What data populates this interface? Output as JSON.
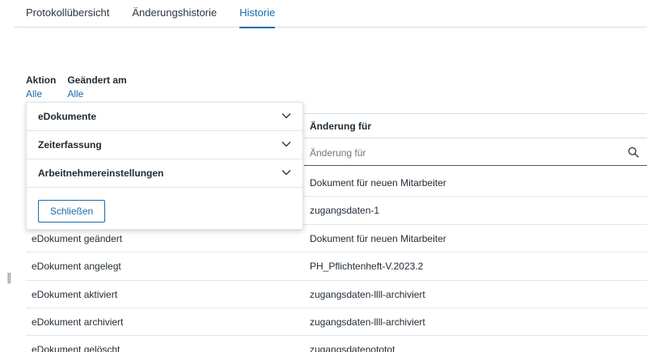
{
  "tabs": [
    {
      "label": "Protokollübersicht",
      "active": false
    },
    {
      "label": "Änderungshistorie",
      "active": false
    },
    {
      "label": "Historie",
      "active": true
    }
  ],
  "filters": {
    "action": {
      "label": "Aktion",
      "value": "Alle"
    },
    "changed_at": {
      "label": "Geändert am",
      "value": "Alle"
    }
  },
  "dropdown": {
    "items": [
      "eDokumente",
      "Zeiterfassung",
      "Arbeitnehmereinstellungen"
    ],
    "close_label": "Schließen"
  },
  "table": {
    "column_right": "Änderung für",
    "filter_placeholder": "Änderung für",
    "rows": [
      {
        "action": "",
        "target": "Dokument für neuen Mitarbeiter"
      },
      {
        "action": "",
        "target": "zugangsdaten-1"
      },
      {
        "action": "eDokument geändert",
        "target": "Dokument für neuen Mitarbeiter"
      },
      {
        "action": "eDokument angelegt",
        "target": "PH_Pflichtenheft-V.2023.2"
      },
      {
        "action": "eDokument aktiviert",
        "target": "zugangsdaten-llll-archiviert"
      },
      {
        "action": "eDokument archiviert",
        "target": "zugangsdaten-llll-archiviert"
      },
      {
        "action": "eDokument gelöscht",
        "target": "zugangsdatenototot"
      }
    ]
  },
  "colors": {
    "accent": "#1a6aa8",
    "text": "#1f2a33",
    "border": "#d8dde2"
  }
}
